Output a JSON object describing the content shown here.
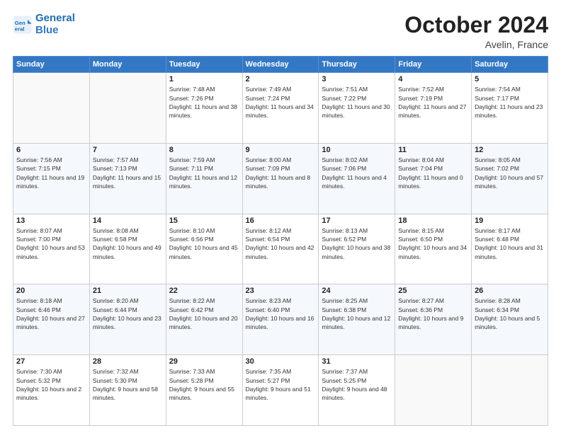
{
  "header": {
    "logo_line1": "General",
    "logo_line2": "Blue",
    "month": "October 2024",
    "location": "Avelin, France"
  },
  "weekdays": [
    "Sunday",
    "Monday",
    "Tuesday",
    "Wednesday",
    "Thursday",
    "Friday",
    "Saturday"
  ],
  "weeks": [
    [
      {
        "day": "",
        "sunrise": "",
        "sunset": "",
        "daylight": ""
      },
      {
        "day": "",
        "sunrise": "",
        "sunset": "",
        "daylight": ""
      },
      {
        "day": "1",
        "sunrise": "Sunrise: 7:48 AM",
        "sunset": "Sunset: 7:26 PM",
        "daylight": "Daylight: 11 hours and 38 minutes."
      },
      {
        "day": "2",
        "sunrise": "Sunrise: 7:49 AM",
        "sunset": "Sunset: 7:24 PM",
        "daylight": "Daylight: 11 hours and 34 minutes."
      },
      {
        "day": "3",
        "sunrise": "Sunrise: 7:51 AM",
        "sunset": "Sunset: 7:22 PM",
        "daylight": "Daylight: 11 hours and 30 minutes."
      },
      {
        "day": "4",
        "sunrise": "Sunrise: 7:52 AM",
        "sunset": "Sunset: 7:19 PM",
        "daylight": "Daylight: 11 hours and 27 minutes."
      },
      {
        "day": "5",
        "sunrise": "Sunrise: 7:54 AM",
        "sunset": "Sunset: 7:17 PM",
        "daylight": "Daylight: 11 hours and 23 minutes."
      }
    ],
    [
      {
        "day": "6",
        "sunrise": "Sunrise: 7:56 AM",
        "sunset": "Sunset: 7:15 PM",
        "daylight": "Daylight: 11 hours and 19 minutes."
      },
      {
        "day": "7",
        "sunrise": "Sunrise: 7:57 AM",
        "sunset": "Sunset: 7:13 PM",
        "daylight": "Daylight: 11 hours and 15 minutes."
      },
      {
        "day": "8",
        "sunrise": "Sunrise: 7:59 AM",
        "sunset": "Sunset: 7:11 PM",
        "daylight": "Daylight: 11 hours and 12 minutes."
      },
      {
        "day": "9",
        "sunrise": "Sunrise: 8:00 AM",
        "sunset": "Sunset: 7:09 PM",
        "daylight": "Daylight: 11 hours and 8 minutes."
      },
      {
        "day": "10",
        "sunrise": "Sunrise: 8:02 AM",
        "sunset": "Sunset: 7:06 PM",
        "daylight": "Daylight: 11 hours and 4 minutes."
      },
      {
        "day": "11",
        "sunrise": "Sunrise: 8:04 AM",
        "sunset": "Sunset: 7:04 PM",
        "daylight": "Daylight: 11 hours and 0 minutes."
      },
      {
        "day": "12",
        "sunrise": "Sunrise: 8:05 AM",
        "sunset": "Sunset: 7:02 PM",
        "daylight": "Daylight: 10 hours and 57 minutes."
      }
    ],
    [
      {
        "day": "13",
        "sunrise": "Sunrise: 8:07 AM",
        "sunset": "Sunset: 7:00 PM",
        "daylight": "Daylight: 10 hours and 53 minutes."
      },
      {
        "day": "14",
        "sunrise": "Sunrise: 8:08 AM",
        "sunset": "Sunset: 6:58 PM",
        "daylight": "Daylight: 10 hours and 49 minutes."
      },
      {
        "day": "15",
        "sunrise": "Sunrise: 8:10 AM",
        "sunset": "Sunset: 6:56 PM",
        "daylight": "Daylight: 10 hours and 45 minutes."
      },
      {
        "day": "16",
        "sunrise": "Sunrise: 8:12 AM",
        "sunset": "Sunset: 6:54 PM",
        "daylight": "Daylight: 10 hours and 42 minutes."
      },
      {
        "day": "17",
        "sunrise": "Sunrise: 8:13 AM",
        "sunset": "Sunset: 6:52 PM",
        "daylight": "Daylight: 10 hours and 38 minutes."
      },
      {
        "day": "18",
        "sunrise": "Sunrise: 8:15 AM",
        "sunset": "Sunset: 6:50 PM",
        "daylight": "Daylight: 10 hours and 34 minutes."
      },
      {
        "day": "19",
        "sunrise": "Sunrise: 8:17 AM",
        "sunset": "Sunset: 6:48 PM",
        "daylight": "Daylight: 10 hours and 31 minutes."
      }
    ],
    [
      {
        "day": "20",
        "sunrise": "Sunrise: 8:18 AM",
        "sunset": "Sunset: 6:46 PM",
        "daylight": "Daylight: 10 hours and 27 minutes."
      },
      {
        "day": "21",
        "sunrise": "Sunrise: 8:20 AM",
        "sunset": "Sunset: 6:44 PM",
        "daylight": "Daylight: 10 hours and 23 minutes."
      },
      {
        "day": "22",
        "sunrise": "Sunrise: 8:22 AM",
        "sunset": "Sunset: 6:42 PM",
        "daylight": "Daylight: 10 hours and 20 minutes."
      },
      {
        "day": "23",
        "sunrise": "Sunrise: 8:23 AM",
        "sunset": "Sunset: 6:40 PM",
        "daylight": "Daylight: 10 hours and 16 minutes."
      },
      {
        "day": "24",
        "sunrise": "Sunrise: 8:25 AM",
        "sunset": "Sunset: 6:38 PM",
        "daylight": "Daylight: 10 hours and 12 minutes."
      },
      {
        "day": "25",
        "sunrise": "Sunrise: 8:27 AM",
        "sunset": "Sunset: 6:36 PM",
        "daylight": "Daylight: 10 hours and 9 minutes."
      },
      {
        "day": "26",
        "sunrise": "Sunrise: 8:28 AM",
        "sunset": "Sunset: 6:34 PM",
        "daylight": "Daylight: 10 hours and 5 minutes."
      }
    ],
    [
      {
        "day": "27",
        "sunrise": "Sunrise: 7:30 AM",
        "sunset": "Sunset: 5:32 PM",
        "daylight": "Daylight: 10 hours and 2 minutes."
      },
      {
        "day": "28",
        "sunrise": "Sunrise: 7:32 AM",
        "sunset": "Sunset: 5:30 PM",
        "daylight": "Daylight: 9 hours and 58 minutes."
      },
      {
        "day": "29",
        "sunrise": "Sunrise: 7:33 AM",
        "sunset": "Sunset: 5:28 PM",
        "daylight": "Daylight: 9 hours and 55 minutes."
      },
      {
        "day": "30",
        "sunrise": "Sunrise: 7:35 AM",
        "sunset": "Sunset: 5:27 PM",
        "daylight": "Daylight: 9 hours and 51 minutes."
      },
      {
        "day": "31",
        "sunrise": "Sunrise: 7:37 AM",
        "sunset": "Sunset: 5:25 PM",
        "daylight": "Daylight: 9 hours and 48 minutes."
      },
      {
        "day": "",
        "sunrise": "",
        "sunset": "",
        "daylight": ""
      },
      {
        "day": "",
        "sunrise": "",
        "sunset": "",
        "daylight": ""
      }
    ]
  ]
}
